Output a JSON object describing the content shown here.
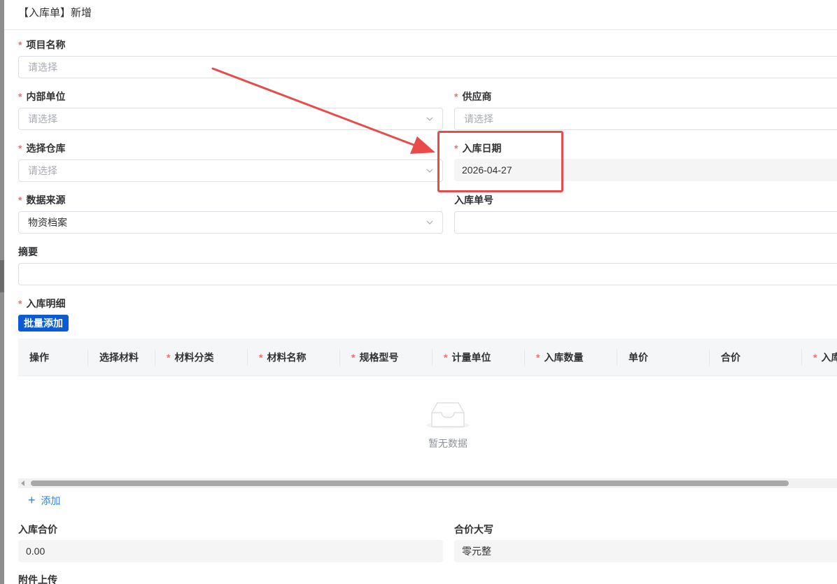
{
  "header": {
    "title": "【入库单】新增"
  },
  "form": {
    "project_name": {
      "label": "项目名称",
      "placeholder": "请选择"
    },
    "internal_unit": {
      "label": "内部单位",
      "placeholder": "请选择"
    },
    "supplier": {
      "label": "供应商",
      "placeholder": "请选择"
    },
    "warehouse": {
      "label": "选择仓库",
      "placeholder": "请选择"
    },
    "entry_date": {
      "label": "入库日期",
      "value": "2026-04-27"
    },
    "data_source": {
      "label": "数据来源",
      "value": "物资档案"
    },
    "entry_no": {
      "label": "入库单号",
      "value": ""
    },
    "summary": {
      "label": "摘要",
      "value": ""
    },
    "details": {
      "label": "入库明细",
      "batch_add_label": "批量添加"
    }
  },
  "table": {
    "columns": [
      {
        "label": "操作",
        "required": false
      },
      {
        "label": "选择材料",
        "required": false
      },
      {
        "label": "材料分类",
        "required": true
      },
      {
        "label": "材料名称",
        "required": true
      },
      {
        "label": "规格型号",
        "required": true
      },
      {
        "label": "计量单位",
        "required": true
      },
      {
        "label": "入库数量",
        "required": true
      },
      {
        "label": "单价",
        "required": false
      },
      {
        "label": "合价",
        "required": false
      },
      {
        "label": "入库",
        "required": true
      }
    ],
    "empty_text": "暂无数据",
    "add_label": "添加"
  },
  "totals": {
    "total_price": {
      "label": "入库合价",
      "value": "0.00"
    },
    "total_upper": {
      "label": "合价大写",
      "value": "零元整"
    }
  },
  "attachment": {
    "label": "附件上传"
  },
  "required_mark": "*",
  "colors": {
    "primary": "#0c5bd2",
    "required": "#f56c6c",
    "annotation": "#e94b4b",
    "link": "#2f7fe8"
  },
  "icons": [
    "chevron-down-icon",
    "empty-box-icon",
    "plus-icon",
    "scroll-left-arrow-icon",
    "annotation-arrow"
  ]
}
